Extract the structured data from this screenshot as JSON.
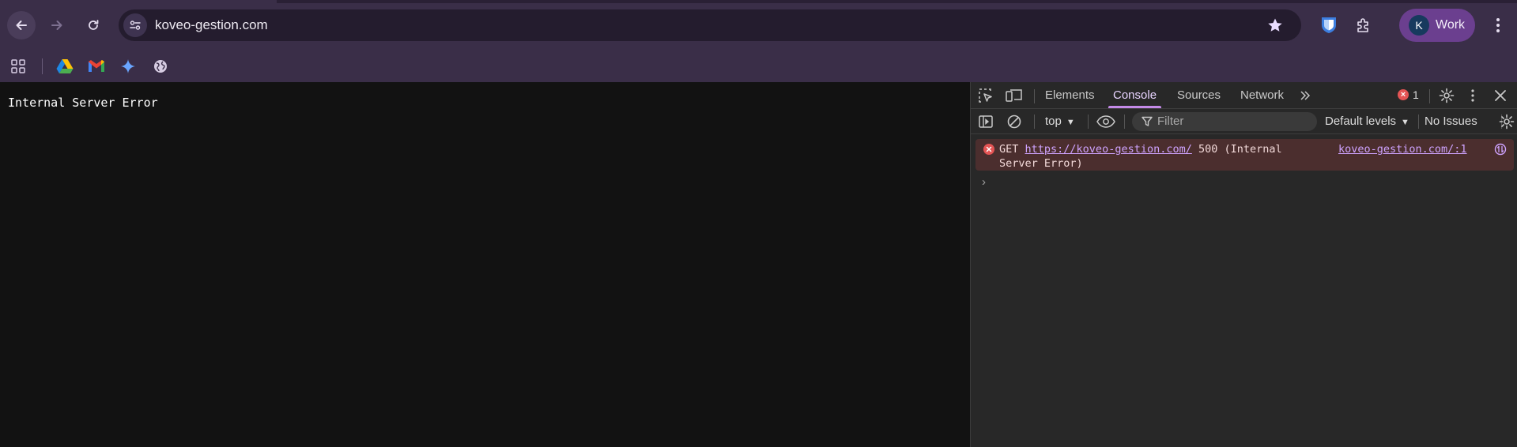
{
  "browser": {
    "url": "koveo-gestion.com",
    "profile": {
      "initial": "K",
      "label": "Work"
    },
    "colors": {
      "chrome": "#3a2e48",
      "omnibox": "#241c2e",
      "profile": "#6b3f8f"
    }
  },
  "bookmarks": {
    "items": [
      "apps-icon",
      "google-drive-icon",
      "gmail-icon",
      "gemini-icon",
      "globe-icon"
    ]
  },
  "page": {
    "text": "Internal Server Error"
  },
  "devtools": {
    "tabs": [
      "Elements",
      "Console",
      "Sources",
      "Network"
    ],
    "active_tab": "Console",
    "error_count": "1",
    "context": "top",
    "filter_placeholder": "Filter",
    "levels": "Default levels",
    "issues": "No Issues",
    "console": {
      "method": "GET",
      "url": "https://koveo-gestion.com/",
      "status": "500 (Internal",
      "status_cont": "Server Error)",
      "source": "koveo-gestion.com/:1",
      "prompt": "›"
    }
  }
}
